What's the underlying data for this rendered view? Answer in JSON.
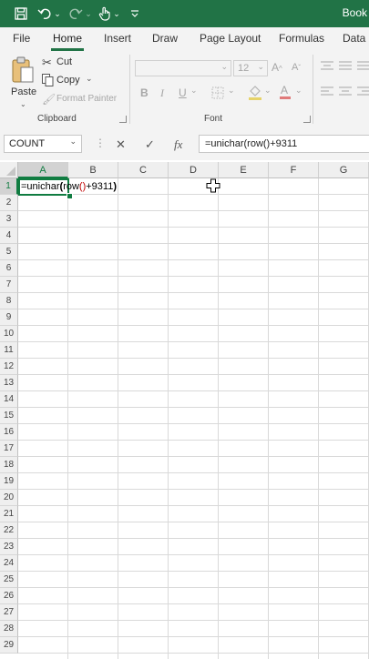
{
  "title_bar": {
    "title": "Book",
    "icons": [
      "save-icon",
      "undo-icon",
      "redo-icon",
      "touch-mode-icon",
      "customize-quick-access-icon"
    ]
  },
  "tabs": [
    "File",
    "Home",
    "Insert",
    "Draw",
    "Page Layout",
    "Formulas",
    "Data"
  ],
  "active_tab": "Home",
  "clipboard": {
    "paste": "Paste",
    "cut": "Cut",
    "copy": "Copy",
    "format_painter": "Format Painter",
    "group_label": "Clipboard"
  },
  "font": {
    "font_size": "12",
    "group_label": "Font",
    "bold": "B",
    "italic": "I",
    "underline": "U",
    "grow": "A",
    "shrink": "A"
  },
  "formula_bar": {
    "name_box": "COUNT",
    "cancel": "✕",
    "enter": "✓",
    "fx": "fx",
    "formula": "=unichar(row()+9311"
  },
  "sheet": {
    "columns": [
      "A",
      "B",
      "C",
      "D",
      "E",
      "F",
      "G"
    ],
    "rows": [
      "1",
      "2",
      "3",
      "4",
      "5",
      "6",
      "7",
      "8",
      "9",
      "10",
      "11",
      "12",
      "13",
      "14",
      "15",
      "16",
      "17",
      "18",
      "19",
      "20",
      "21",
      "22",
      "23",
      "24",
      "25",
      "26",
      "27",
      "28",
      "29"
    ],
    "active_cell_text": "=unichar(row()+9311)",
    "edit_parts": [
      "=unichar",
      "(",
      "row",
      "()",
      "+9311",
      ")"
    ]
  },
  "colors": {
    "excel_green": "#217346",
    "selection_green": "#107c41",
    "paren_black": "#000000",
    "paren_red": "#c00000"
  }
}
